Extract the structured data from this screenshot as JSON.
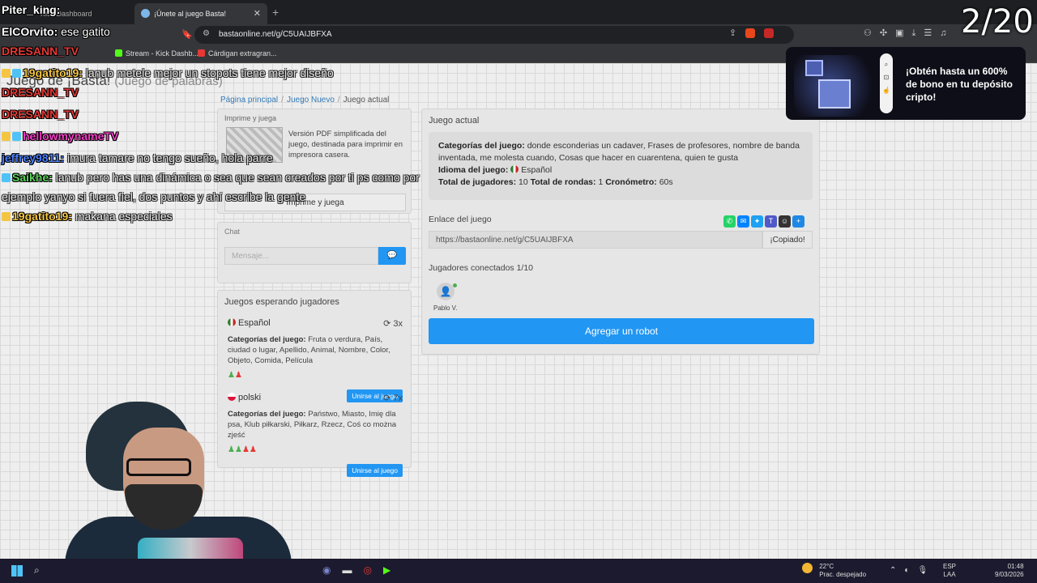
{
  "browser": {
    "tabs": [
      {
        "label": "Kick Dashboard",
        "active": false
      },
      {
        "label": "¡Únete al juego Basta!",
        "active": true
      }
    ],
    "url": "bastaonline.net/g/C5UAIJBFXA",
    "bookmarks": [
      {
        "label": "Stream - Kick Dashb...",
        "color": "#53fc18"
      },
      {
        "label": "Cárdigan extragran...",
        "color": "#e53935"
      }
    ]
  },
  "site": {
    "title": "Juego de ¡Basta!",
    "subtitle": "(Juego de palabras)"
  },
  "breadcrumb": {
    "home": "Página principal",
    "new_game": "Juego Nuevo",
    "current": "Juego actual"
  },
  "print_panel": {
    "title": "Imprime y juega",
    "description": "Versión PDF simplificada del juego, destinada para imprimir en impresora casera.",
    "button": "Imprime y juega"
  },
  "chat_panel": {
    "title": "Chat",
    "placeholder": "Mensaje..."
  },
  "waiting_panel": {
    "title": "Juegos esperando jugadores",
    "games": [
      {
        "language": "Español",
        "count": "3x",
        "categories_label": "Categorías del juego:",
        "categories": "Fruta o verdura, País, ciudad o lugar, Apellido, Animal, Nombre, Color, Objeto, Comida, Película",
        "join": "Unirse al juego"
      },
      {
        "language": "polski",
        "count": "7x",
        "categories_label": "Categorías del juego:",
        "categories": "Państwo, Miasto, Imię dla psa, Klub piłkarski, Piłkarz, Rzecz, Coś co można zjeść",
        "join": "Unirse al juego"
      }
    ]
  },
  "current_game": {
    "title": "Juego actual",
    "categories_label": "Categorías del juego:",
    "categories": "donde esconderias un cadaver, Frases de profesores, nombre de banda inventada, me molesta cuando, Cosas que hacer en cuarentena, quien te gusta",
    "language_label": "Idioma del juego:",
    "language": "Español",
    "total_players_label": "Total de jugadores:",
    "total_players": "10",
    "total_rounds_label": "Total de rondas:",
    "total_rounds": "1",
    "timer_label": "Cronómetro:",
    "timer": "60s",
    "link_label": "Enlace del juego",
    "link": "https://bastaonline.net/g/C5UAIJBFXA",
    "copy_button": "¡Copiado!",
    "connected_label": "Jugadores conectados 1/10",
    "player_name": "Pablo V.",
    "add_robot": "Agregar un robot"
  },
  "ad": {
    "text": "¡Obtén hasta un 600% de bono en tu depósito cripto!"
  },
  "counter": "2/20",
  "stream_chat": [
    {
      "user": "Piter_king:",
      "message": "",
      "color": "#ffffff"
    },
    {
      "user": "ElCOrvito:",
      "message": "ese gatito",
      "color": "#ffffff"
    },
    {
      "user": "DRESANN_TV",
      "message": "",
      "color": "#e53935"
    },
    {
      "user": "19gatito19:",
      "message": "lanub metele mejor un stopots tiene mejor diseño",
      "color": "#f5c542"
    },
    {
      "user": "DRESANN_TV",
      "message": "",
      "color": "#e53935"
    },
    {
      "user": "DRESANN_TV",
      "message": "",
      "color": "#e53935"
    },
    {
      "user": "hellowmynameTV",
      "message": "",
      "color": "#f53fc8"
    },
    {
      "user": "jeffrey9811:",
      "message": "imura tamare no tengo sueño, hola parre",
      "color": "#4a7cf7"
    },
    {
      "user": "Saikhe:",
      "message": "lanub pero has una dinámica o sea que sean creados por ti ps como por",
      "color": "#5dd35d"
    },
    {
      "user": "",
      "message": "ejemplo yanyo si fuera fiel, dos puntos y ahí escribe la gente",
      "color": "#ffffff"
    },
    {
      "user": "19gatito19:",
      "message": "makana especiales",
      "color": "#f5c542"
    }
  ],
  "taskbar": {
    "temperature": "22°C",
    "weather": "Prac. despejado",
    "lang1": "ESP",
    "lang2": "LAA",
    "time": "01:48",
    "date": "9/03/2026"
  },
  "colors": {
    "accent": "#2196f3",
    "page_bg": "#eeeeee"
  }
}
